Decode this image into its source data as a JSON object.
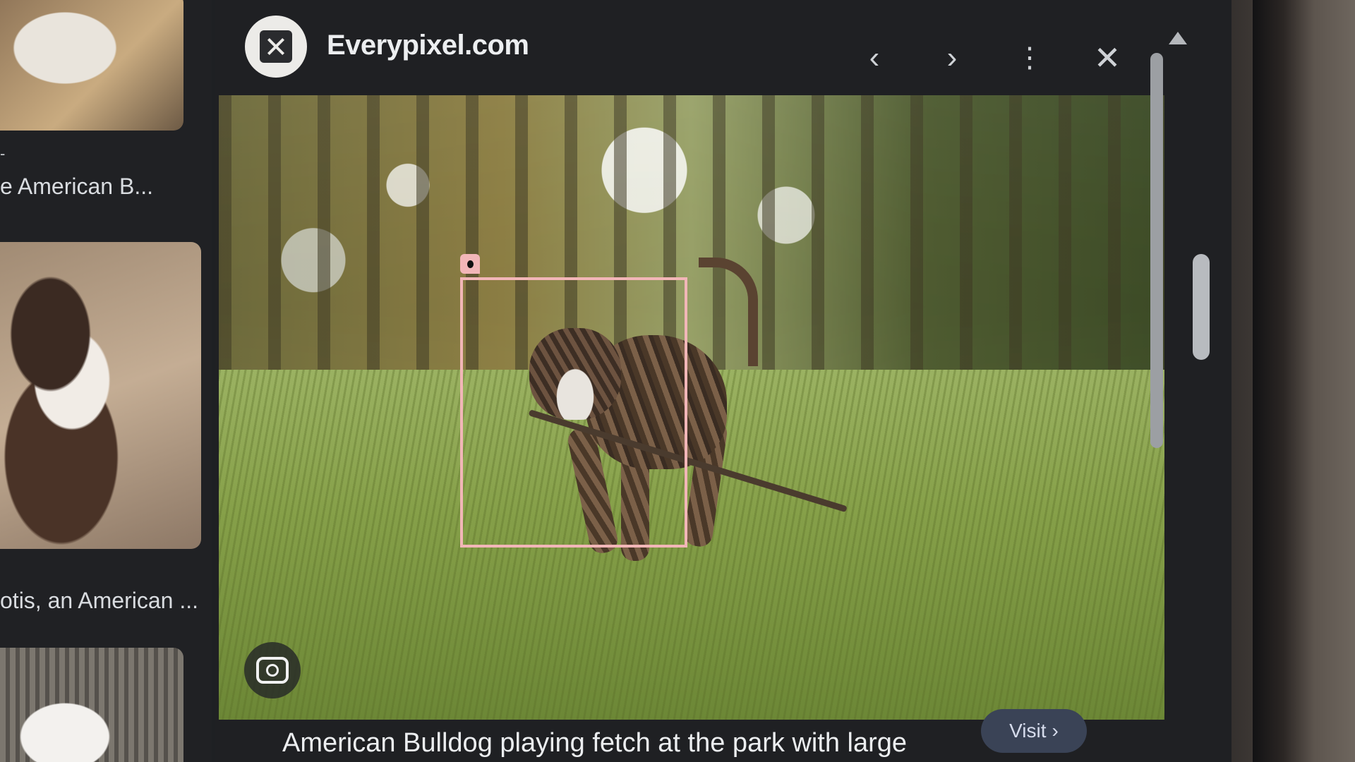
{
  "results": {
    "caption_1": "e American B...",
    "caption_2": "otis, an American ...",
    "dash": "-"
  },
  "viewer": {
    "site_name": "Everypixel.com",
    "caption": "American Bulldog playing fetch at the park with large",
    "visit_label": "Visit",
    "visit_chevron": "›"
  },
  "icons": {
    "prev": "‹",
    "next": "›",
    "more": "⋮",
    "close": "✕"
  }
}
